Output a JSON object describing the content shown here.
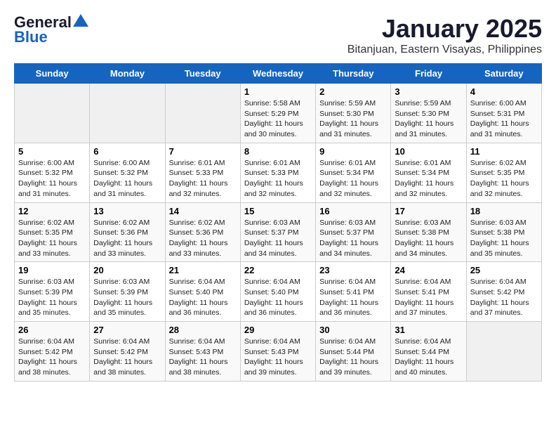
{
  "logo": {
    "line1": "General",
    "line2": "Blue"
  },
  "title": "January 2025",
  "subtitle": "Bitanjuan, Eastern Visayas, Philippines",
  "weekdays": [
    "Sunday",
    "Monday",
    "Tuesday",
    "Wednesday",
    "Thursday",
    "Friday",
    "Saturday"
  ],
  "weeks": [
    [
      {
        "day": "",
        "info": ""
      },
      {
        "day": "",
        "info": ""
      },
      {
        "day": "",
        "info": ""
      },
      {
        "day": "1",
        "info": "Sunrise: 5:58 AM\nSunset: 5:29 PM\nDaylight: 11 hours\nand 30 minutes."
      },
      {
        "day": "2",
        "info": "Sunrise: 5:59 AM\nSunset: 5:30 PM\nDaylight: 11 hours\nand 31 minutes."
      },
      {
        "day": "3",
        "info": "Sunrise: 5:59 AM\nSunset: 5:30 PM\nDaylight: 11 hours\nand 31 minutes."
      },
      {
        "day": "4",
        "info": "Sunrise: 6:00 AM\nSunset: 5:31 PM\nDaylight: 11 hours\nand 31 minutes."
      }
    ],
    [
      {
        "day": "5",
        "info": "Sunrise: 6:00 AM\nSunset: 5:32 PM\nDaylight: 11 hours\nand 31 minutes."
      },
      {
        "day": "6",
        "info": "Sunrise: 6:00 AM\nSunset: 5:32 PM\nDaylight: 11 hours\nand 31 minutes."
      },
      {
        "day": "7",
        "info": "Sunrise: 6:01 AM\nSunset: 5:33 PM\nDaylight: 11 hours\nand 32 minutes."
      },
      {
        "day": "8",
        "info": "Sunrise: 6:01 AM\nSunset: 5:33 PM\nDaylight: 11 hours\nand 32 minutes."
      },
      {
        "day": "9",
        "info": "Sunrise: 6:01 AM\nSunset: 5:34 PM\nDaylight: 11 hours\nand 32 minutes."
      },
      {
        "day": "10",
        "info": "Sunrise: 6:01 AM\nSunset: 5:34 PM\nDaylight: 11 hours\nand 32 minutes."
      },
      {
        "day": "11",
        "info": "Sunrise: 6:02 AM\nSunset: 5:35 PM\nDaylight: 11 hours\nand 32 minutes."
      }
    ],
    [
      {
        "day": "12",
        "info": "Sunrise: 6:02 AM\nSunset: 5:35 PM\nDaylight: 11 hours\nand 33 minutes."
      },
      {
        "day": "13",
        "info": "Sunrise: 6:02 AM\nSunset: 5:36 PM\nDaylight: 11 hours\nand 33 minutes."
      },
      {
        "day": "14",
        "info": "Sunrise: 6:02 AM\nSunset: 5:36 PM\nDaylight: 11 hours\nand 33 minutes."
      },
      {
        "day": "15",
        "info": "Sunrise: 6:03 AM\nSunset: 5:37 PM\nDaylight: 11 hours\nand 34 minutes."
      },
      {
        "day": "16",
        "info": "Sunrise: 6:03 AM\nSunset: 5:37 PM\nDaylight: 11 hours\nand 34 minutes."
      },
      {
        "day": "17",
        "info": "Sunrise: 6:03 AM\nSunset: 5:38 PM\nDaylight: 11 hours\nand 34 minutes."
      },
      {
        "day": "18",
        "info": "Sunrise: 6:03 AM\nSunset: 5:38 PM\nDaylight: 11 hours\nand 35 minutes."
      }
    ],
    [
      {
        "day": "19",
        "info": "Sunrise: 6:03 AM\nSunset: 5:39 PM\nDaylight: 11 hours\nand 35 minutes."
      },
      {
        "day": "20",
        "info": "Sunrise: 6:03 AM\nSunset: 5:39 PM\nDaylight: 11 hours\nand 35 minutes."
      },
      {
        "day": "21",
        "info": "Sunrise: 6:04 AM\nSunset: 5:40 PM\nDaylight: 11 hours\nand 36 minutes."
      },
      {
        "day": "22",
        "info": "Sunrise: 6:04 AM\nSunset: 5:40 PM\nDaylight: 11 hours\nand 36 minutes."
      },
      {
        "day": "23",
        "info": "Sunrise: 6:04 AM\nSunset: 5:41 PM\nDaylight: 11 hours\nand 36 minutes."
      },
      {
        "day": "24",
        "info": "Sunrise: 6:04 AM\nSunset: 5:41 PM\nDaylight: 11 hours\nand 37 minutes."
      },
      {
        "day": "25",
        "info": "Sunrise: 6:04 AM\nSunset: 5:42 PM\nDaylight: 11 hours\nand 37 minutes."
      }
    ],
    [
      {
        "day": "26",
        "info": "Sunrise: 6:04 AM\nSunset: 5:42 PM\nDaylight: 11 hours\nand 38 minutes."
      },
      {
        "day": "27",
        "info": "Sunrise: 6:04 AM\nSunset: 5:42 PM\nDaylight: 11 hours\nand 38 minutes."
      },
      {
        "day": "28",
        "info": "Sunrise: 6:04 AM\nSunset: 5:43 PM\nDaylight: 11 hours\nand 38 minutes."
      },
      {
        "day": "29",
        "info": "Sunrise: 6:04 AM\nSunset: 5:43 PM\nDaylight: 11 hours\nand 39 minutes."
      },
      {
        "day": "30",
        "info": "Sunrise: 6:04 AM\nSunset: 5:44 PM\nDaylight: 11 hours\nand 39 minutes."
      },
      {
        "day": "31",
        "info": "Sunrise: 6:04 AM\nSunset: 5:44 PM\nDaylight: 11 hours\nand 40 minutes."
      },
      {
        "day": "",
        "info": ""
      }
    ]
  ]
}
